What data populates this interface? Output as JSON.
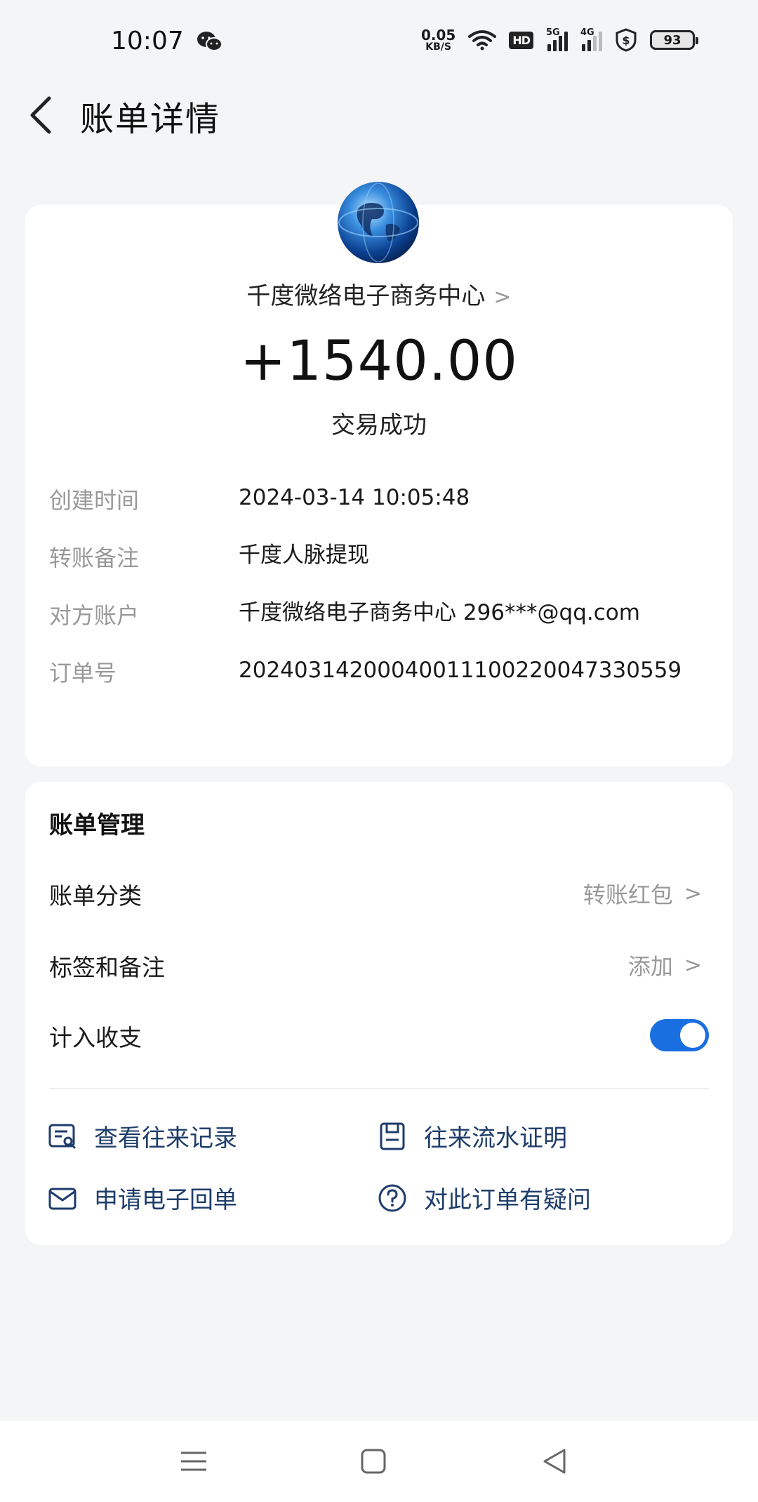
{
  "status_bar": {
    "time": "10:07",
    "net_speed_value": "0.05",
    "net_speed_unit": "KB/S",
    "hd_badge": "HD",
    "sim1_label": "5G",
    "sim2_label": "4G",
    "battery": "93"
  },
  "header": {
    "title": "账单详情"
  },
  "transaction": {
    "merchant": "千度微络电子商务中心",
    "amount": "+1540.00",
    "status": "交易成功",
    "details": [
      {
        "label": "创建时间",
        "value": "2024-03-14 10:05:48"
      },
      {
        "label": "转账备注",
        "value": "千度人脉提现"
      },
      {
        "label": "对方账户",
        "value": "千度微络电子商务中心 296***@qq.com"
      },
      {
        "label": "订单号",
        "value": "20240314200040011100220047330559"
      }
    ]
  },
  "management": {
    "title": "账单管理",
    "rows": [
      {
        "label": "账单分类",
        "value": "转账红包"
      },
      {
        "label": "标签和备注",
        "value": "添加"
      },
      {
        "label": "计入收支",
        "toggle_on": true
      }
    ],
    "links": [
      {
        "label": "查看往来记录",
        "icon": "record-search-icon"
      },
      {
        "label": "往来流水证明",
        "icon": "document-icon"
      },
      {
        "label": "申请电子回单",
        "icon": "envelope-icon"
      },
      {
        "label": "对此订单有疑问",
        "icon": "question-icon"
      }
    ]
  },
  "colors": {
    "accent": "#1a6fe0",
    "link": "#1e3d6b",
    "muted": "#999999",
    "background": "#f4f5f7"
  },
  "navbar": {
    "icons": [
      "menu-icon",
      "home-icon",
      "back-triangle-icon"
    ]
  }
}
